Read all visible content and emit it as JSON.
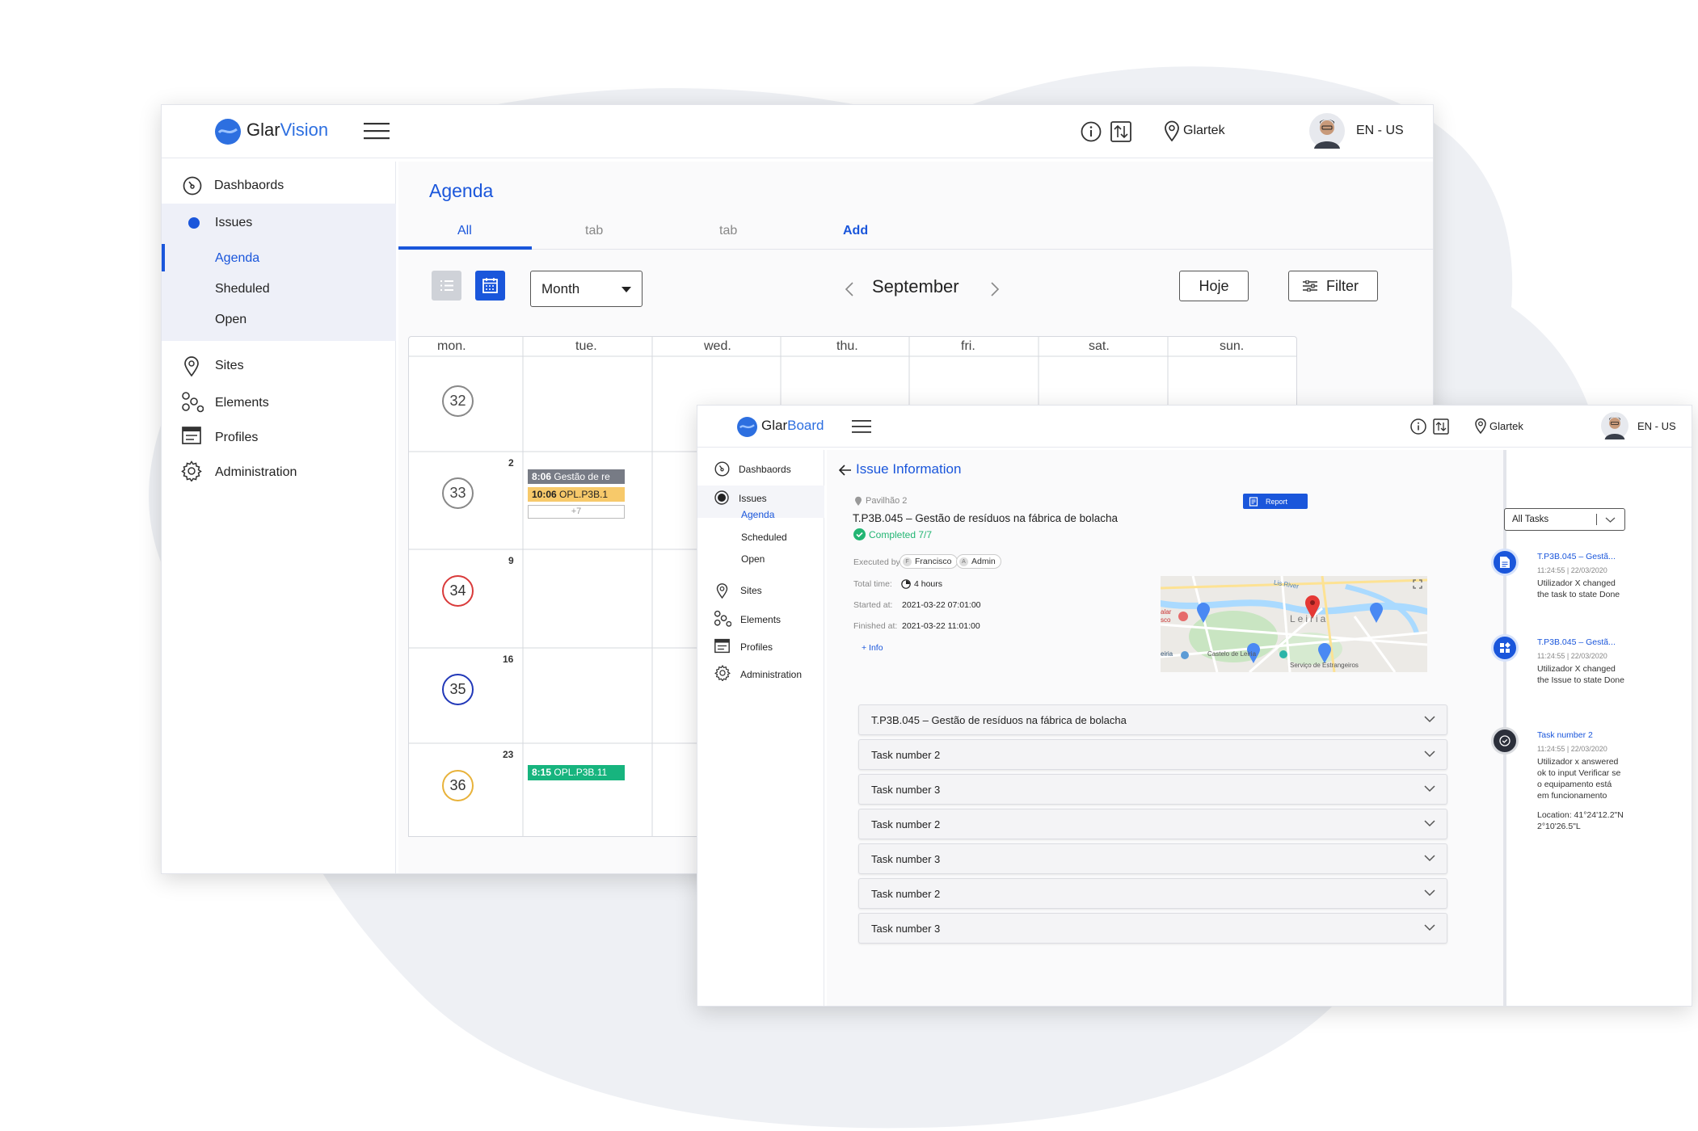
{
  "colors": {
    "accent": "#1a56db",
    "brand": "#2d6fe0",
    "week34": "#d93a3a",
    "week35": "#2138b8",
    "week36": "#e8b23a",
    "week32": "#888888",
    "green": "#22b573",
    "yellow": "#f7c96a",
    "grey_event": "#777b85",
    "teal_event": "#17b47e"
  },
  "window1": {
    "logo": {
      "part1": "Glar",
      "part2": "Vision"
    },
    "header": {
      "location": "Glartek",
      "language": "EN - US"
    },
    "sidebar": {
      "dashboards": "Dashbaords",
      "issues": "Issues",
      "agenda": "Agenda",
      "scheduled": "Sheduled",
      "open": "Open",
      "sites": "Sites",
      "elements": "Elements",
      "profiles": "Profiles",
      "administration": "Administration"
    },
    "page_title": "Agenda",
    "tabs": [
      "All",
      "tab",
      "tab",
      "Add"
    ],
    "toolbar": {
      "view_select": "Month",
      "month": "September",
      "today_button": "Hoje",
      "filter_button": "Filter"
    },
    "calendar": {
      "days": [
        "mon.",
        "tue.",
        "wed.",
        "thu.",
        "fri.",
        "sat.",
        "sun."
      ],
      "weeks": [
        "32",
        "33",
        "34",
        "35",
        "36"
      ],
      "dates": [
        "2",
        "9",
        "16",
        "23"
      ],
      "events": [
        {
          "time": "8:06",
          "title": "Gestão de re"
        },
        {
          "time": "10:06",
          "title": "OPL.P3B.1"
        },
        {
          "more": "+7"
        },
        {
          "time": "8:15",
          "title": "OPL.P3B.11"
        }
      ]
    }
  },
  "window2": {
    "logo": {
      "part1": "Glar",
      "part2": "Board"
    },
    "header": {
      "location": "Glartek",
      "language": "EN - US"
    },
    "sidebar": {
      "dashboards": "Dashbaords",
      "issues": "Issues",
      "agenda": "Agenda",
      "scheduled": "Scheduled",
      "open": "Open",
      "sites": "Sites",
      "elements": "Elements",
      "profiles": "Profiles",
      "administration": "Administration"
    },
    "page_title": "Issue Information",
    "issue": {
      "location": "Pavilhão 2",
      "report_button": "Report",
      "title": "T.P3B.045 – Gestão de resíduos na fábrica de bolacha",
      "status": "Completed 7/7",
      "executed_by_label": "Executed by:",
      "executors": [
        {
          "initial": "F",
          "name": "Francisco"
        },
        {
          "initial": "A",
          "name": "Admin"
        }
      ],
      "total_time_label": "Total time:",
      "total_time": "4 hours",
      "started_label": "Started at:",
      "started": "2021-03-22 07:01:00",
      "finished_label": "Finished at:",
      "finished": "2021-03-22 11:01:00",
      "info_link": "+  Info"
    },
    "map": {
      "labels": [
        "Lis River",
        "Leiria",
        "alar",
        "sco",
        "eiria",
        "Castelo de Leiria",
        "Serviço de Estrangeiros"
      ]
    },
    "accordion": [
      "T.P3B.045 – Gestão de resíduos na fábrica de bolacha",
      "Task number 2",
      "Task number 3",
      "Task number 2",
      "Task number 3",
      "Task number 2",
      "Task number 3"
    ],
    "timeline": {
      "filter": "All Tasks",
      "items": [
        {
          "title": "T.P3B.045 – Gestã...",
          "time": "11:24:55 | 22/03/2020",
          "text": [
            "Utilizador X changed",
            "the task to state Done"
          ]
        },
        {
          "title": "T.P3B.045 – Gestã...",
          "time": "11:24:55 | 22/03/2020",
          "text": [
            "Utilizador X changed",
            "the Issue to state Done"
          ]
        },
        {
          "title": "Task number 2",
          "time": "11:24:55 | 22/03/2020",
          "text": [
            "Utilizador x answered",
            "ok to input Verificar se",
            "o equipamento está",
            "em funcionamento"
          ],
          "location": [
            "Location: 41°24'12.2\"N",
            "2°10'26.5\"L"
          ]
        }
      ]
    }
  }
}
